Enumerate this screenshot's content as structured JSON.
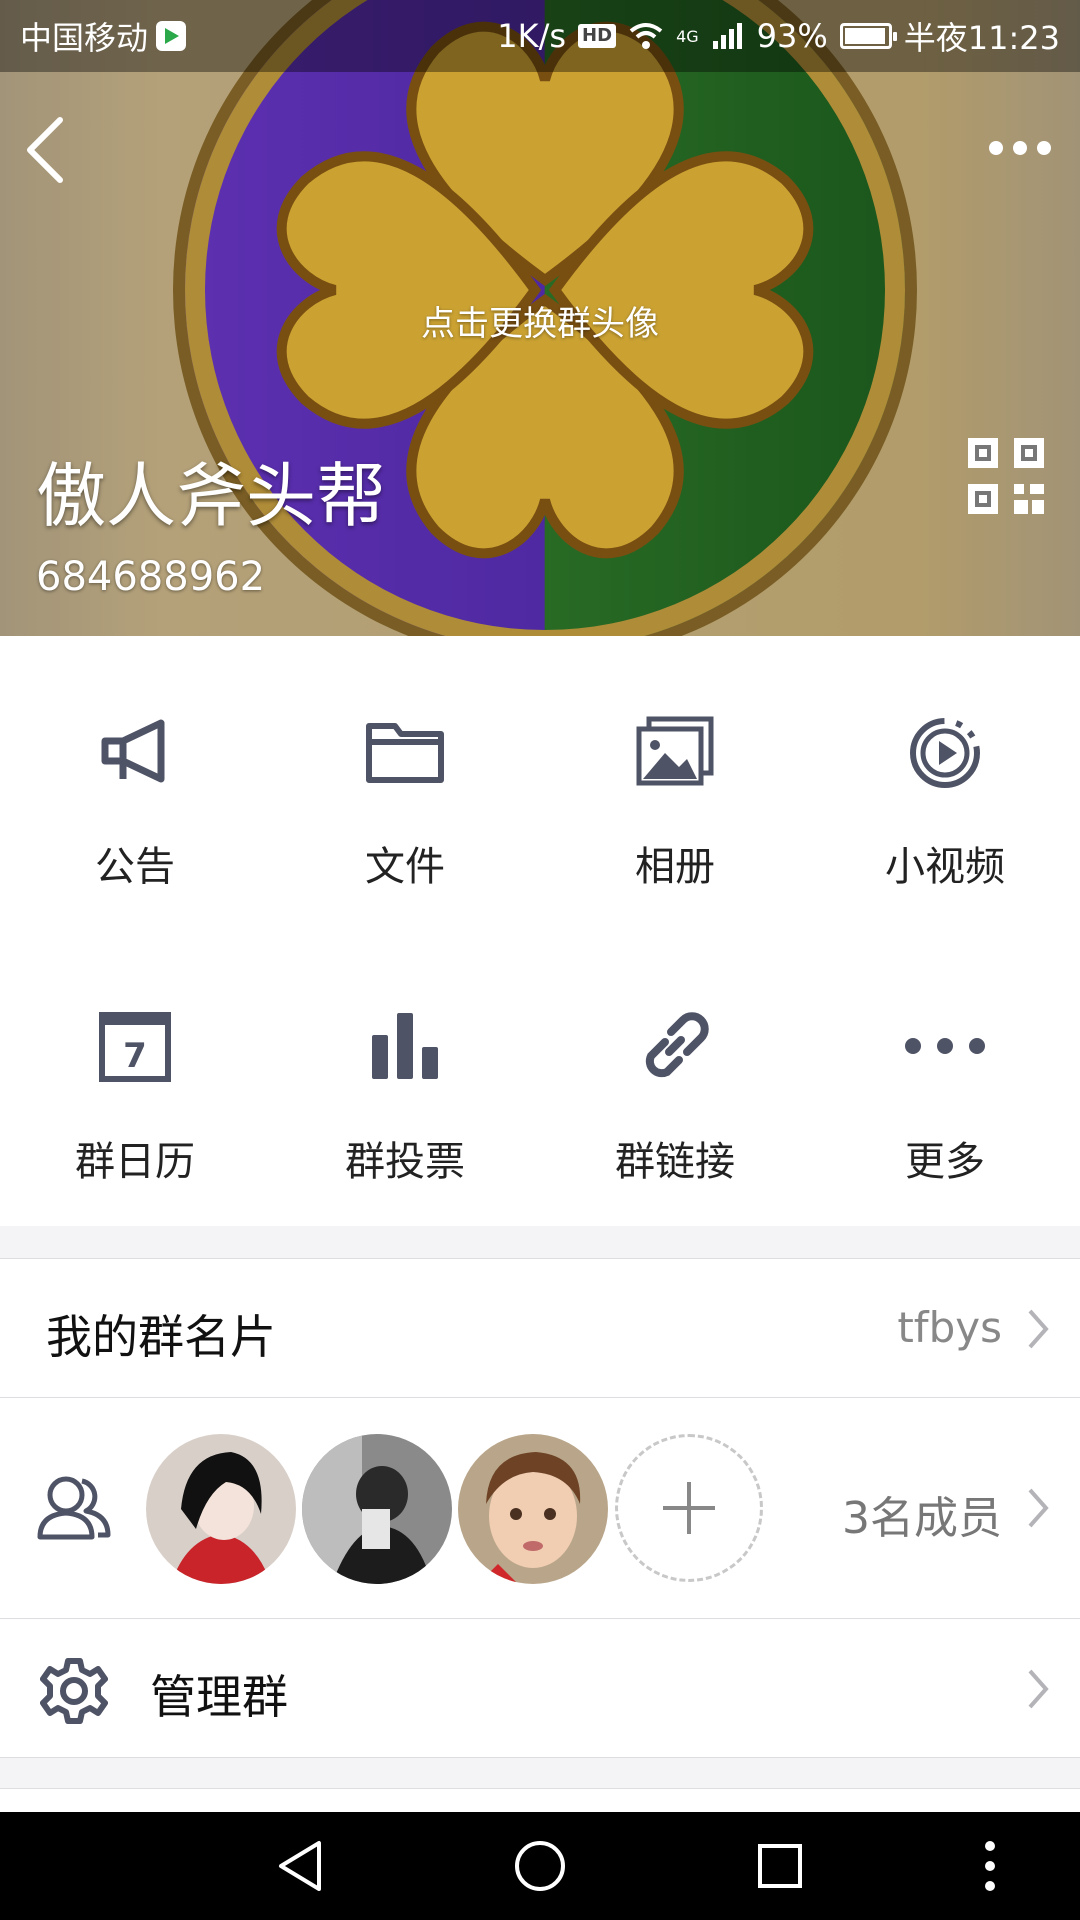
{
  "status_bar": {
    "carrier": "中国移动",
    "net_speed": "1K/s",
    "hd": "HD",
    "network": "4G",
    "battery": "93%",
    "time": "半夜11:23"
  },
  "header": {
    "change_avatar_hint": "点击更换群头像",
    "group_name": "傲人斧头帮",
    "group_number": "684688962"
  },
  "features": [
    {
      "label": "公告",
      "icon": "megaphone-icon"
    },
    {
      "label": "文件",
      "icon": "folder-icon"
    },
    {
      "label": "相册",
      "icon": "album-icon"
    },
    {
      "label": "小视频",
      "icon": "video-icon"
    },
    {
      "label": "群日历",
      "icon": "calendar-icon"
    },
    {
      "label": "群投票",
      "icon": "vote-icon"
    },
    {
      "label": "群链接",
      "icon": "link-icon"
    },
    {
      "label": "更多",
      "icon": "more-icon"
    }
  ],
  "calendar_day": "7",
  "my_card": {
    "title": "我的群名片",
    "value": "tfbys"
  },
  "members": {
    "count_label": "3名成员"
  },
  "manage": {
    "title": "管理群"
  },
  "colors": {
    "icon": "#4f5366",
    "accent_bg": "#ffffff"
  }
}
